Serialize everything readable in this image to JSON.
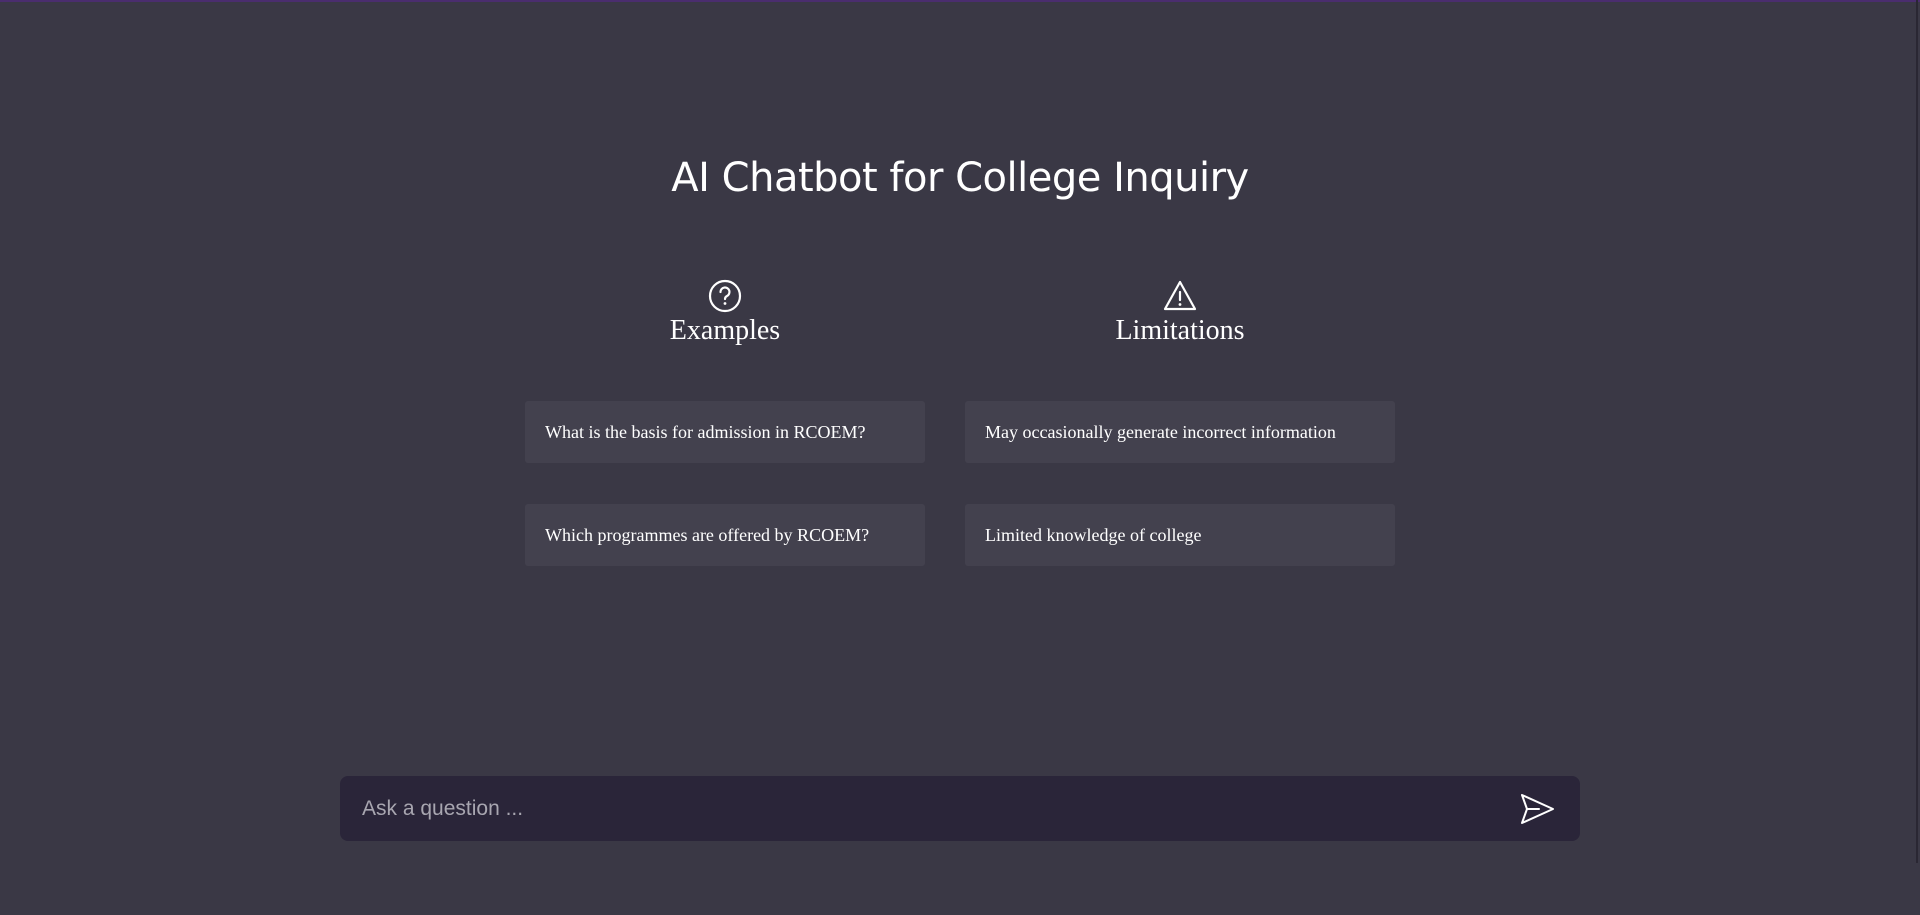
{
  "page": {
    "title": "AI Chatbot for College Inquiry"
  },
  "examples": {
    "icon": "question-circle-icon",
    "heading": "Examples",
    "items": [
      "What is the basis for admission in RCOEM?",
      "Which programmes are offered by RCOEM?"
    ]
  },
  "limitations": {
    "icon": "warning-triangle-icon",
    "heading": "Limitations",
    "items": [
      "May occasionally generate incorrect information",
      "Limited knowledge of college"
    ]
  },
  "chat_input": {
    "placeholder": "Ask a question ...",
    "value": "",
    "send_icon": "send-icon"
  },
  "colors": {
    "background": "#3a3845",
    "card": "#43414e",
    "input_bar": "#2a2539",
    "text": "#ffffff",
    "top_border": "#4a2d6e"
  }
}
